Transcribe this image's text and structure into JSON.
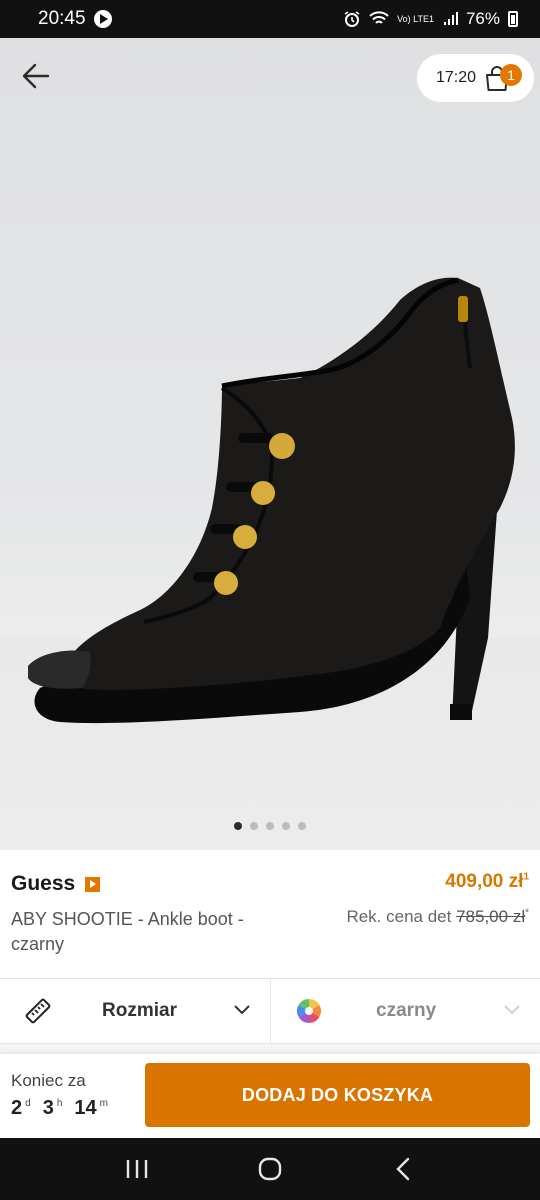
{
  "status_bar": {
    "time": "20:45",
    "network": "Vo) LTE1",
    "battery": "76%"
  },
  "header": {
    "timer": "17:20",
    "cart_count": "1"
  },
  "gallery": {
    "dots": 5,
    "active_index": 0
  },
  "product": {
    "brand": "Guess",
    "name": "ABY SHOOTIE - Ankle boot - czarny",
    "price": "409,00 zł",
    "price_note": "1",
    "rrp_label": "Rek. cena det",
    "rrp_value": "785,00 zł",
    "rrp_note": "*"
  },
  "selectors": {
    "size_label": "Rozmiar",
    "color_label": "czarny"
  },
  "footer": {
    "countdown_label": "Koniec za",
    "days": "2",
    "days_unit": "d",
    "hours": "3",
    "hours_unit": "h",
    "minutes": "14",
    "minutes_unit": "m",
    "cta_label": "DODAJ DO KOSZYKA"
  },
  "colors": {
    "accent": "#d97400",
    "badge": "#e37800",
    "price": "#d67800"
  }
}
